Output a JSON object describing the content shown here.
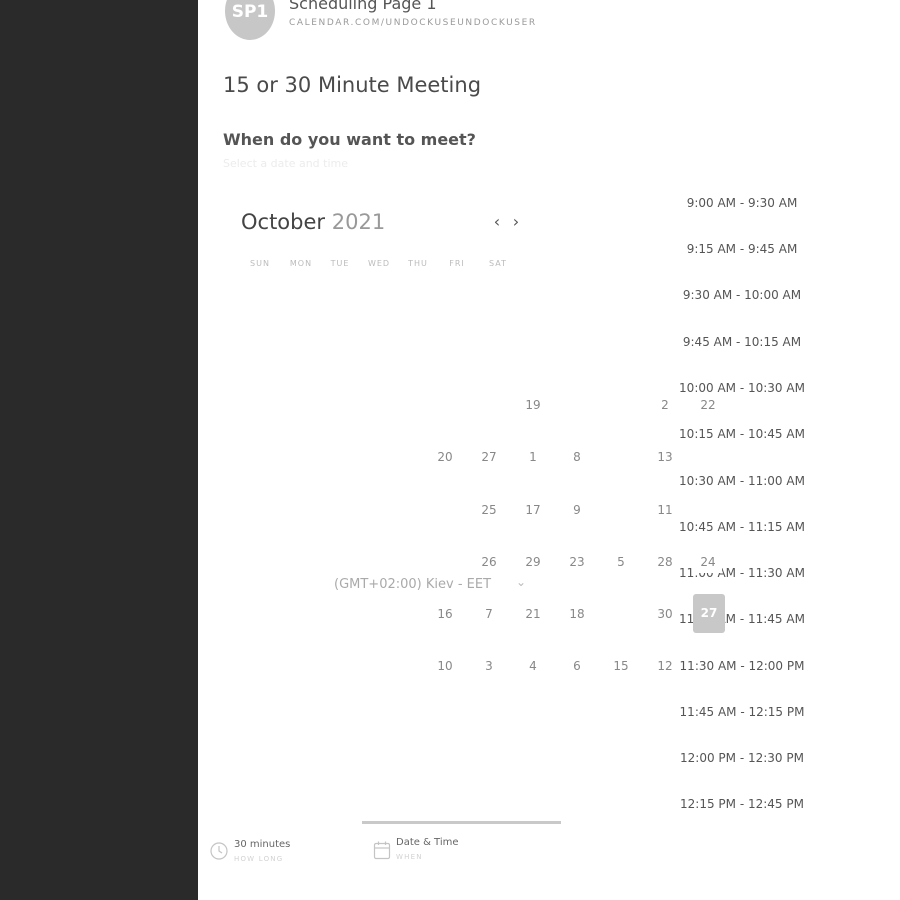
{
  "header": {
    "avatar_initials": "SP1",
    "page_name": "Scheduling Page 1",
    "page_url": "CALENDAR.COM/UNDOCKUSEUNDOCKUSER"
  },
  "meeting": {
    "title": "15 or 30 Minute Meeting",
    "question": "When do you want to meet?",
    "hint": "Select a date and time"
  },
  "calendar": {
    "month": "October",
    "year": "2021",
    "prev_icon": "chevron-left-icon",
    "next_icon": "chevron-right-icon",
    "weekdays": [
      "SUN",
      "MON",
      "TUE",
      "WED",
      "THU",
      "FRI",
      "SAT"
    ],
    "days": [
      "19",
      "2",
      "22",
      "20",
      "27",
      "1",
      "8",
      "13",
      "25",
      "17",
      "9",
      "11",
      "26",
      "29",
      "23",
      "5",
      "28",
      "24",
      "16",
      "7",
      "21",
      "18",
      "30",
      "27",
      "10",
      "3",
      "4",
      "6",
      "15",
      "12"
    ],
    "selected_day": "27"
  },
  "timezone": {
    "label": "(GMT+02:00) Kiev - EET",
    "chevron_icon": "chevron-down-icon"
  },
  "time_slots": [
    "9:00 AM - 9:30 AM",
    "9:15 AM - 9:45 AM",
    "9:30 AM - 10:00 AM",
    "9:45 AM - 10:15 AM",
    "10:00 AM - 10:30 AM",
    "10:15 AM - 10:45 AM",
    "10:30 AM - 11:00 AM",
    "10:45 AM - 11:15 AM",
    "11:00 AM - 11:30 AM",
    "11:15 AM - 11:45 AM",
    "11:30 AM - 12:00 PM",
    "11:45 AM - 12:15 PM",
    "12:00 PM - 12:30 PM",
    "12:15 PM - 12:45 PM"
  ],
  "bottom_tabs": [
    {
      "label": "30 minutes",
      "sublabel": "HOW LONG",
      "icon": "clock-icon"
    },
    {
      "label": "Date & Time",
      "sublabel": "WHEN",
      "icon": "calendar-icon"
    }
  ]
}
